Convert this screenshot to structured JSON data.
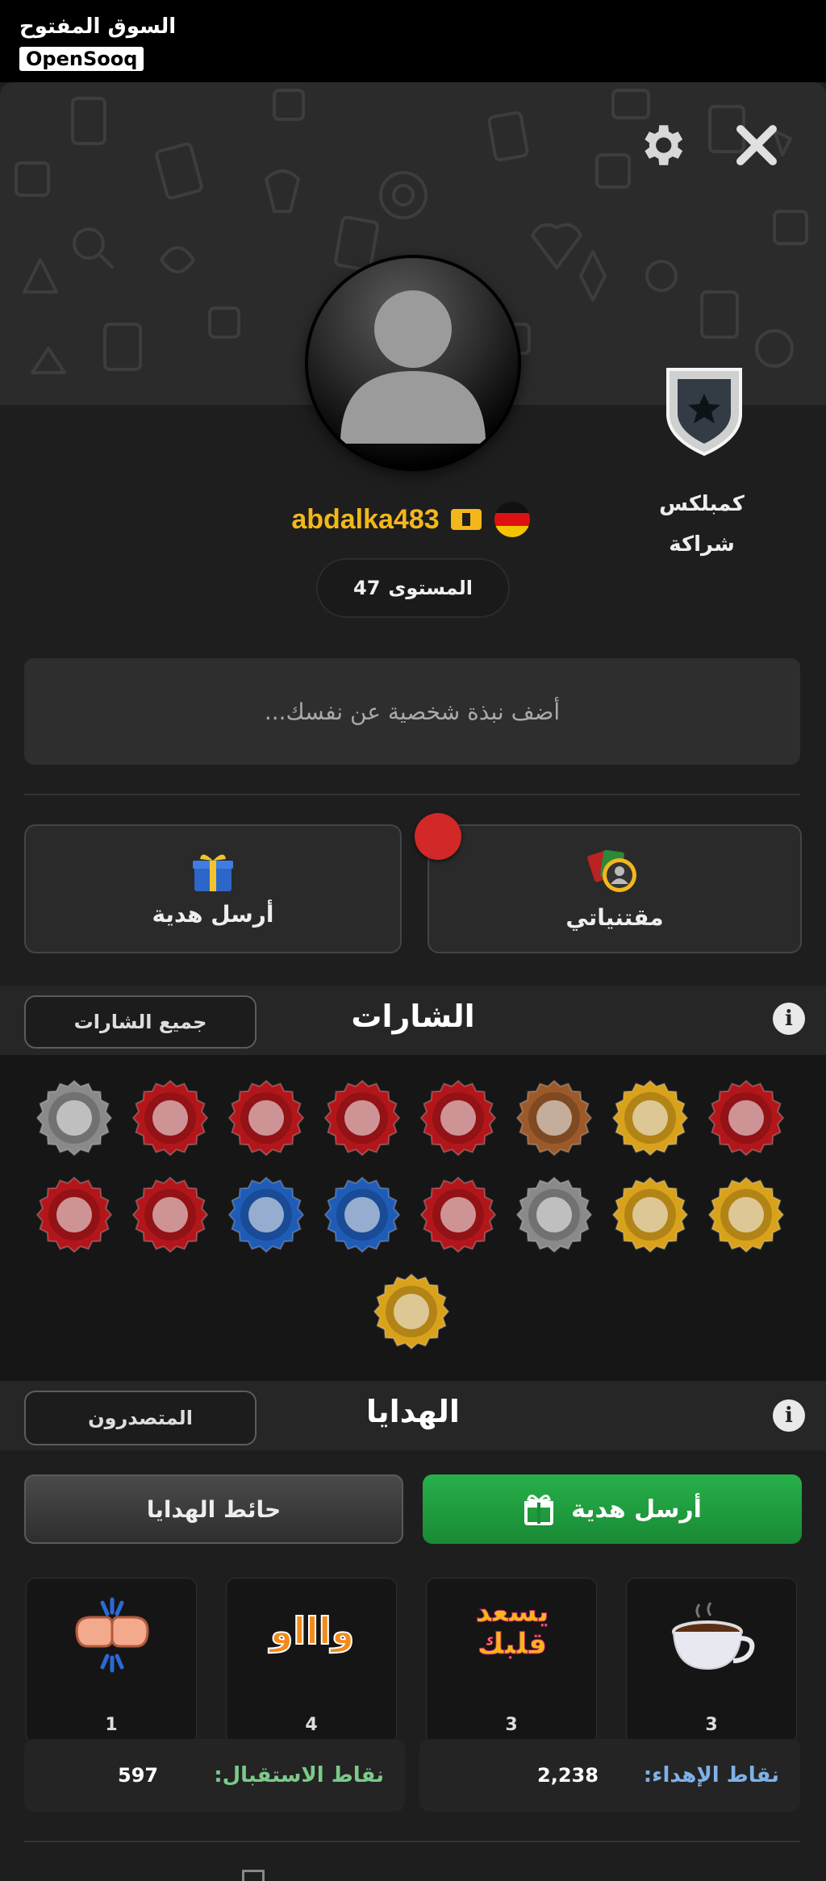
{
  "watermark": {
    "arabic": "السوق المفتوح",
    "english": "OpenSooq"
  },
  "header": {
    "settings_icon": "gear-icon",
    "close_icon": "close-icon"
  },
  "profile": {
    "username": "abdalka483",
    "rank_title_line1": "كمبلكس",
    "rank_title_line2": "شراكة",
    "level_label": "المستوى",
    "level_value": "47",
    "bio_placeholder": "أضف نبذة شخصية عن نفسك..."
  },
  "actions": {
    "send_gift_label": "أرسل هدية",
    "inventory_label": "مقتنياتي"
  },
  "badges": {
    "title": "الشارات",
    "all_button": "جميع الشارات",
    "row1": [
      {
        "icon": "crossed-swords-icon",
        "color": "#b2161b"
      },
      {
        "icon": "trophy-icon",
        "color": "#d9a21b"
      },
      {
        "icon": "rocket-icon",
        "color": "#9c5a2a"
      },
      {
        "icon": "card-icon",
        "color": "#b2161b"
      },
      {
        "icon": "king-card-icon",
        "color": "#b2161b"
      },
      {
        "icon": "queen-card-icon",
        "color": "#b2161b"
      },
      {
        "icon": "king-card-icon",
        "color": "#b2161b"
      },
      {
        "icon": "ace-spade-icon",
        "color": "#8a8a8a"
      }
    ],
    "row2": [
      {
        "icon": "coffee-cup-icon",
        "color": "#d9a21b"
      },
      {
        "icon": "group-icon",
        "color": "#d9a21b"
      },
      {
        "icon": "fez-hat-icon",
        "color": "#8a8a8a"
      },
      {
        "icon": "profile-icon",
        "color": "#b2161b"
      },
      {
        "icon": "facebook-icon",
        "color": "#1f5cb8"
      },
      {
        "icon": "person-arms-up-icon",
        "color": "#1f5cb8"
      },
      {
        "icon": "running-man-icon",
        "color": "#b2161b"
      },
      {
        "icon": "spade-card-icon",
        "color": "#b2161b"
      }
    ],
    "row3": [
      {
        "icon": "trophy-ring-icon",
        "color": "#d9a21b"
      }
    ]
  },
  "gifts": {
    "title": "الهدايا",
    "leaders_button": "المتصدرون",
    "wall_button": "حائط الهدايا",
    "send_button": "أرسل هدية",
    "items": [
      {
        "icon": "fist-bump-icon",
        "count": "1"
      },
      {
        "icon": "waaw-sticker-icon",
        "label": "واااو",
        "count": "4"
      },
      {
        "icon": "yasad-albak-sticker-icon",
        "label": "يسعد قلبك",
        "count": "3"
      },
      {
        "icon": "coffee-cup-icon",
        "count": "3"
      }
    ],
    "receive_points_label": "نقاط الاستقبال:",
    "receive_points_value": "597",
    "gift_points_label": "نقاط الإهداء:",
    "gift_points_value": "2,238"
  },
  "colors": {
    "accent_gold": "#f3b71a",
    "send_green": "#1f9b3a",
    "notification_red": "#d22828"
  }
}
